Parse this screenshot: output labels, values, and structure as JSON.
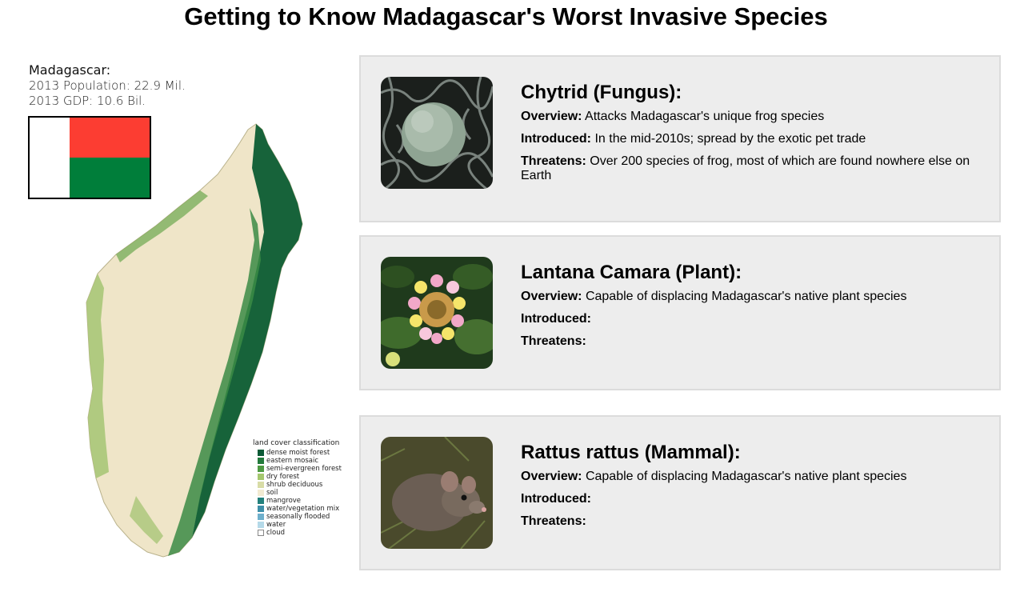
{
  "page": {
    "title": "Getting to Know Madagascar's Worst Invasive Species"
  },
  "country": {
    "name": "Madagascar:",
    "population": "2013 Population: 22.9 Mil.",
    "gdp": "2013 GDP: 10.6 Bil.",
    "flag_colors": {
      "white": "#ffffff",
      "red": "#fc3d32",
      "green": "#007e3a"
    }
  },
  "map": {
    "legend_title": "land cover classification",
    "legend": [
      {
        "label": "dense moist forest",
        "color": "#0b5a36"
      },
      {
        "label": "eastern mosaic",
        "color": "#237a3c"
      },
      {
        "label": "semi-evergreen forest",
        "color": "#4e9a43"
      },
      {
        "label": "dry forest",
        "color": "#a4c76e"
      },
      {
        "label": "shrub deciduous",
        "color": "#d8dca6"
      },
      {
        "label": "soil",
        "color": "#f2ead2"
      },
      {
        "label": "mangrove",
        "color": "#23807c"
      },
      {
        "label": "water/vegetation mix",
        "color": "#3e8fa8"
      },
      {
        "label": "seasonally flooded",
        "color": "#6fb0cc"
      },
      {
        "label": "water",
        "color": "#b4d9e8"
      },
      {
        "label": "cloud",
        "color": "#ffffff"
      }
    ]
  },
  "species": [
    {
      "title": "Chytrid (Fungus):",
      "image_icon": "fungus-micrograph",
      "overview_label": "Overview:",
      "overview": "Attacks Madagascar's unique frog species",
      "introduced_label": "Introduced:",
      "introduced": "In the mid-2010s; spread by the exotic pet trade",
      "threatens_label": "Threatens:",
      "threatens": "Over 200 species of frog, most of which are found nowhere else on Earth"
    },
    {
      "title": "Lantana Camara (Plant):",
      "image_icon": "flower",
      "overview_label": "Overview:",
      "overview": "Capable of displacing Madagascar's native plant species",
      "introduced_label": "Introduced:",
      "introduced": "",
      "threatens_label": "Threatens:",
      "threatens": ""
    },
    {
      "title": "Rattus rattus (Mammal):",
      "image_icon": "rat",
      "overview_label": "Overview:",
      "overview": "Capable of displacing Madagascar's native plant species",
      "introduced_label": "Introduced:",
      "introduced": "",
      "threatens_label": "Threatens:",
      "threatens": ""
    }
  ]
}
